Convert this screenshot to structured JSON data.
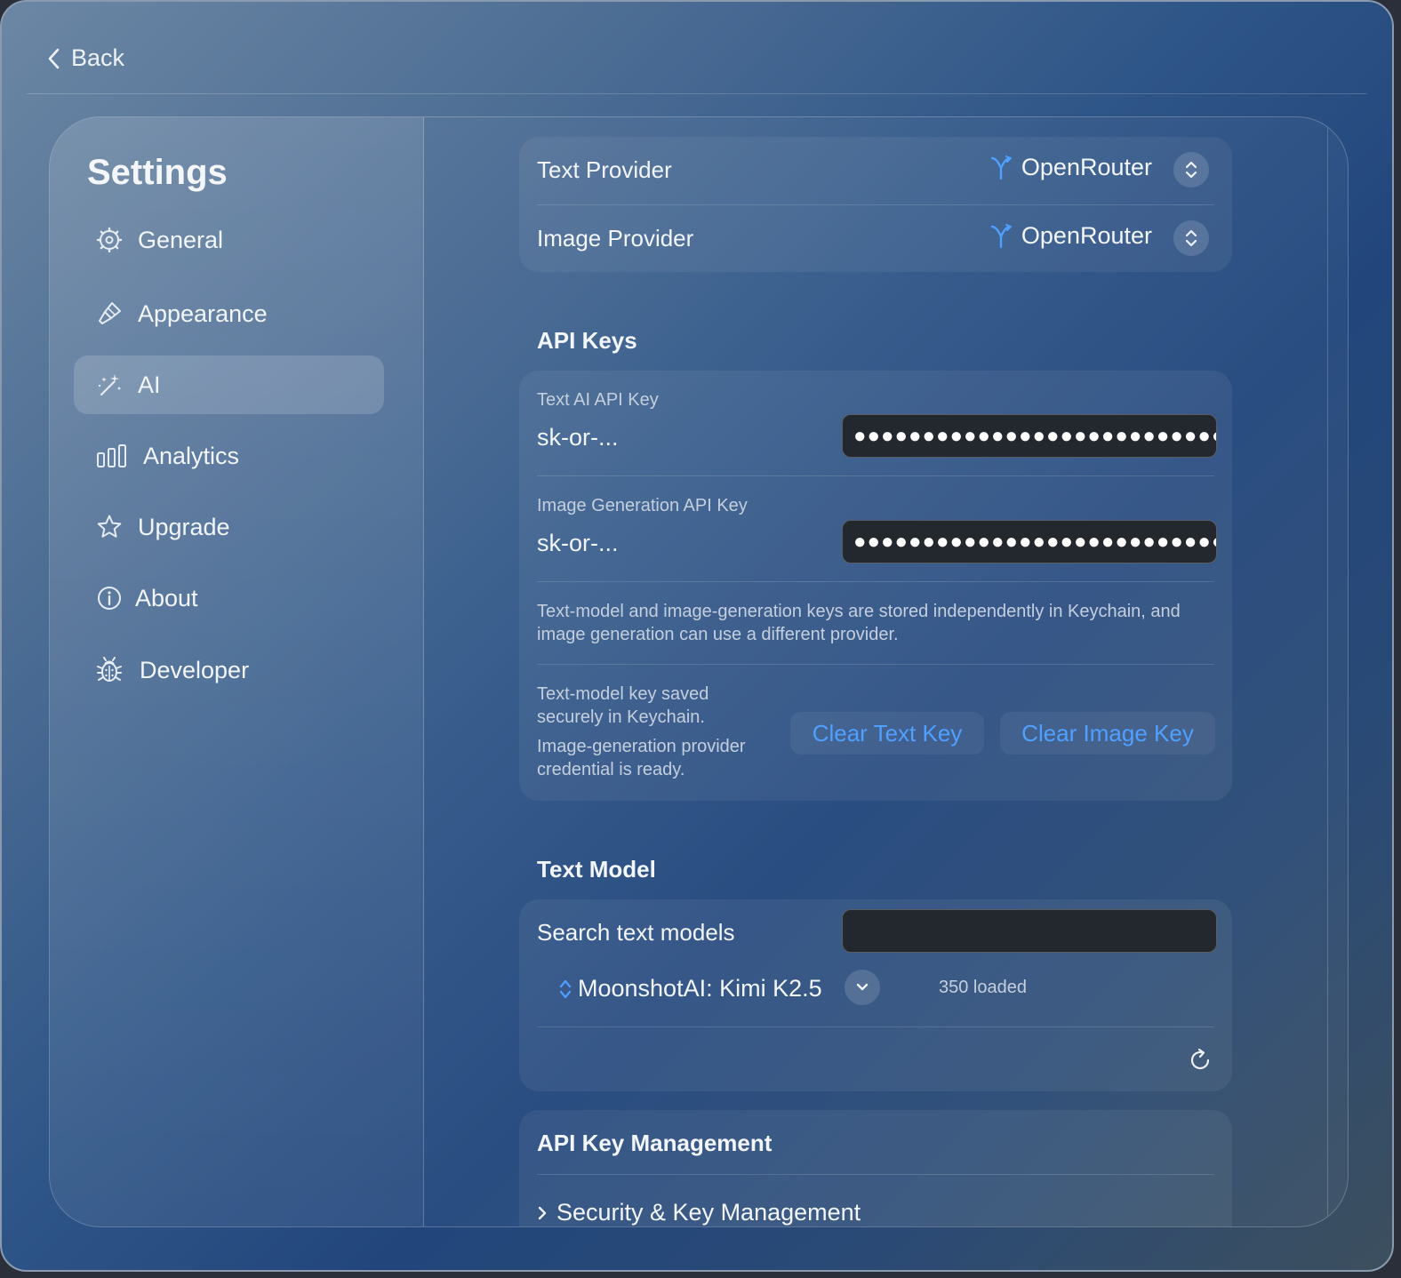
{
  "topbar": {
    "back_label": "Back"
  },
  "sidebar": {
    "title": "Settings",
    "items": [
      {
        "label": "General",
        "icon": "gear-icon"
      },
      {
        "label": "Appearance",
        "icon": "paintbrush-icon"
      },
      {
        "label": "AI",
        "icon": "magic-wand-icon",
        "active": true
      },
      {
        "label": "Analytics",
        "icon": "bar-chart-icon"
      },
      {
        "label": "Upgrade",
        "icon": "star-icon"
      },
      {
        "label": "About",
        "icon": "info-icon"
      },
      {
        "label": "Developer",
        "icon": "bug-icon"
      }
    ]
  },
  "providers": {
    "text_label": "Text Provider",
    "text_value": "OpenRouter",
    "image_label": "Image Provider",
    "image_value": "OpenRouter"
  },
  "api_keys": {
    "section_title": "API Keys",
    "text_key_caption": "Text AI API Key",
    "text_key_value": "sk-or-...",
    "text_key_masked": "●●●●●●●●●●●●●●●●●●●●●●●●●●●●",
    "image_key_caption": "Image Generation API Key",
    "image_key_value": "sk-or-...",
    "image_key_masked": "●●●●●●●●●●●●●●●●●●●●●●●●●●●●",
    "storage_note": "Text-model and image-generation keys are stored independently in Keychain, and image generation can use a different provider.",
    "status_text_1": "Text-model key saved securely in Keychain.",
    "status_text_2": "Image-generation provider credential is ready.",
    "clear_text_label": "Clear Text Key",
    "clear_image_label": "Clear Image Key"
  },
  "text_model": {
    "section_title": "Text Model",
    "search_label": "Search text models",
    "search_value": "",
    "selected_model": "MoonshotAI: Kimi K2.5",
    "loaded_count": "350 loaded"
  },
  "key_management": {
    "section_title": "API Key Management",
    "disclosure_label": "Security & Key Management"
  },
  "colors": {
    "accent": "#4fa0ff",
    "field_bg": "#23272e"
  }
}
